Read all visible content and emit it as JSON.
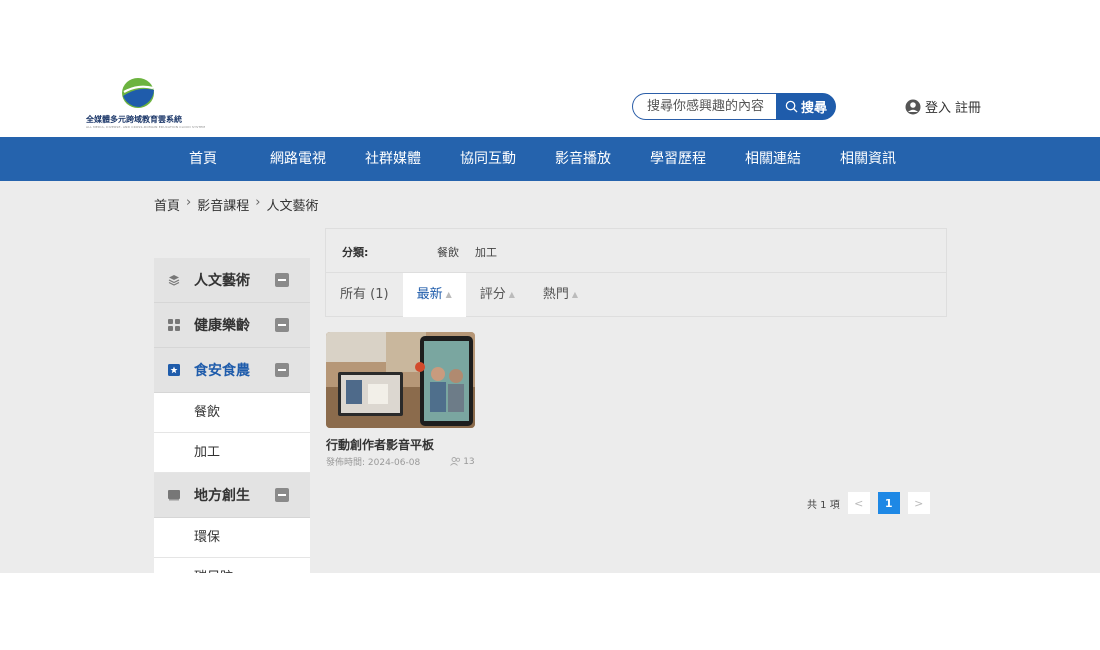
{
  "header": {
    "logo_title": "全媒體多元跨域教育雲系統",
    "logo_subtitle": "ALL MEDIA, DIVERSE, AND CROSS-DOMAIN EDUCATION CLOUD SYSTEM",
    "search_placeholder": "搜尋你感興趣的內容",
    "search_button": "搜尋",
    "login": "登入",
    "register": "註冊"
  },
  "nav": {
    "items": [
      "首頁",
      "網路電視",
      "社群媒體",
      "協同互動",
      "影音播放",
      "學習歷程",
      "相關連結",
      "相關資訊"
    ]
  },
  "breadcrumb": [
    "首頁",
    "影音課程",
    "人文藝術"
  ],
  "sidebar": {
    "categories": [
      {
        "label": "人文藝術",
        "icon": "layers-icon"
      },
      {
        "label": "健康樂齡",
        "icon": "grid-icon"
      },
      {
        "label": "食安食農",
        "icon": "star-box-icon",
        "subs": [
          "餐飲",
          "加工"
        ]
      },
      {
        "label": "地方創生",
        "icon": "book-icon",
        "subs": [
          "環保",
          "碳足跡"
        ]
      }
    ]
  },
  "filter": {
    "label": "分類:",
    "options": [
      "餐飲",
      "加工"
    ]
  },
  "tabs": [
    {
      "label": "所有 (1)"
    },
    {
      "label": "最新"
    },
    {
      "label": "評分"
    },
    {
      "label": "熱門"
    }
  ],
  "card": {
    "title": "行動創作者影音平板",
    "published": "發佈時間: 2024-06-08",
    "views": "13"
  },
  "pagination": {
    "total": "共 1 項",
    "current": "1",
    "prev": "<",
    "next": ">"
  },
  "colors": {
    "brand": "#2563ad",
    "accent": "#1e88e5",
    "active_text": "#1f5cab"
  }
}
